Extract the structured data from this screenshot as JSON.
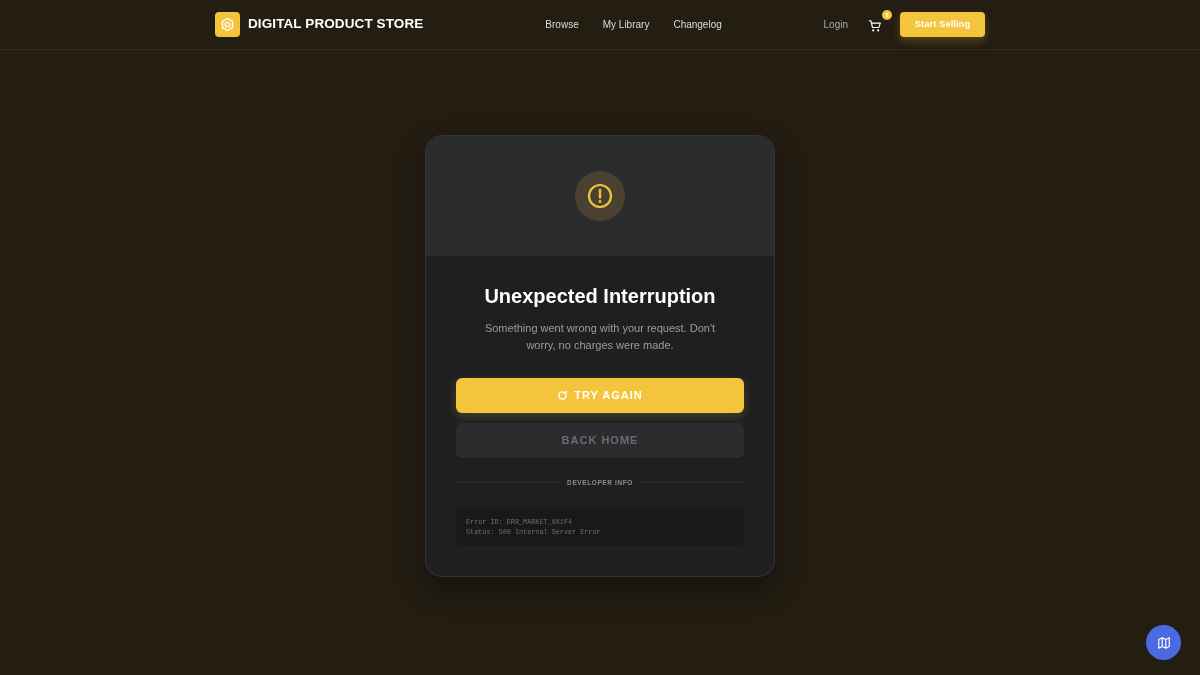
{
  "navbar": {
    "brand": "DIGITAL PRODUCT STORE",
    "links": [
      {
        "label": "Browse"
      },
      {
        "label": "My Library"
      },
      {
        "label": "Changelog"
      }
    ],
    "login": "Login",
    "cart_badge": "$",
    "cta": "Start Selling"
  },
  "error_card": {
    "title": "Unexpected Interruption",
    "message": "Something went wrong with your request. Don't worry, no charges were made.",
    "primary_action": "TRY AGAIN",
    "secondary_action": "BACK HOME",
    "divider_label": "DEVELOPER INFO",
    "details": [
      "Error ID: ERR_MARKET_0X1F4",
      "Status: 500 Internal Server Error"
    ]
  }
}
